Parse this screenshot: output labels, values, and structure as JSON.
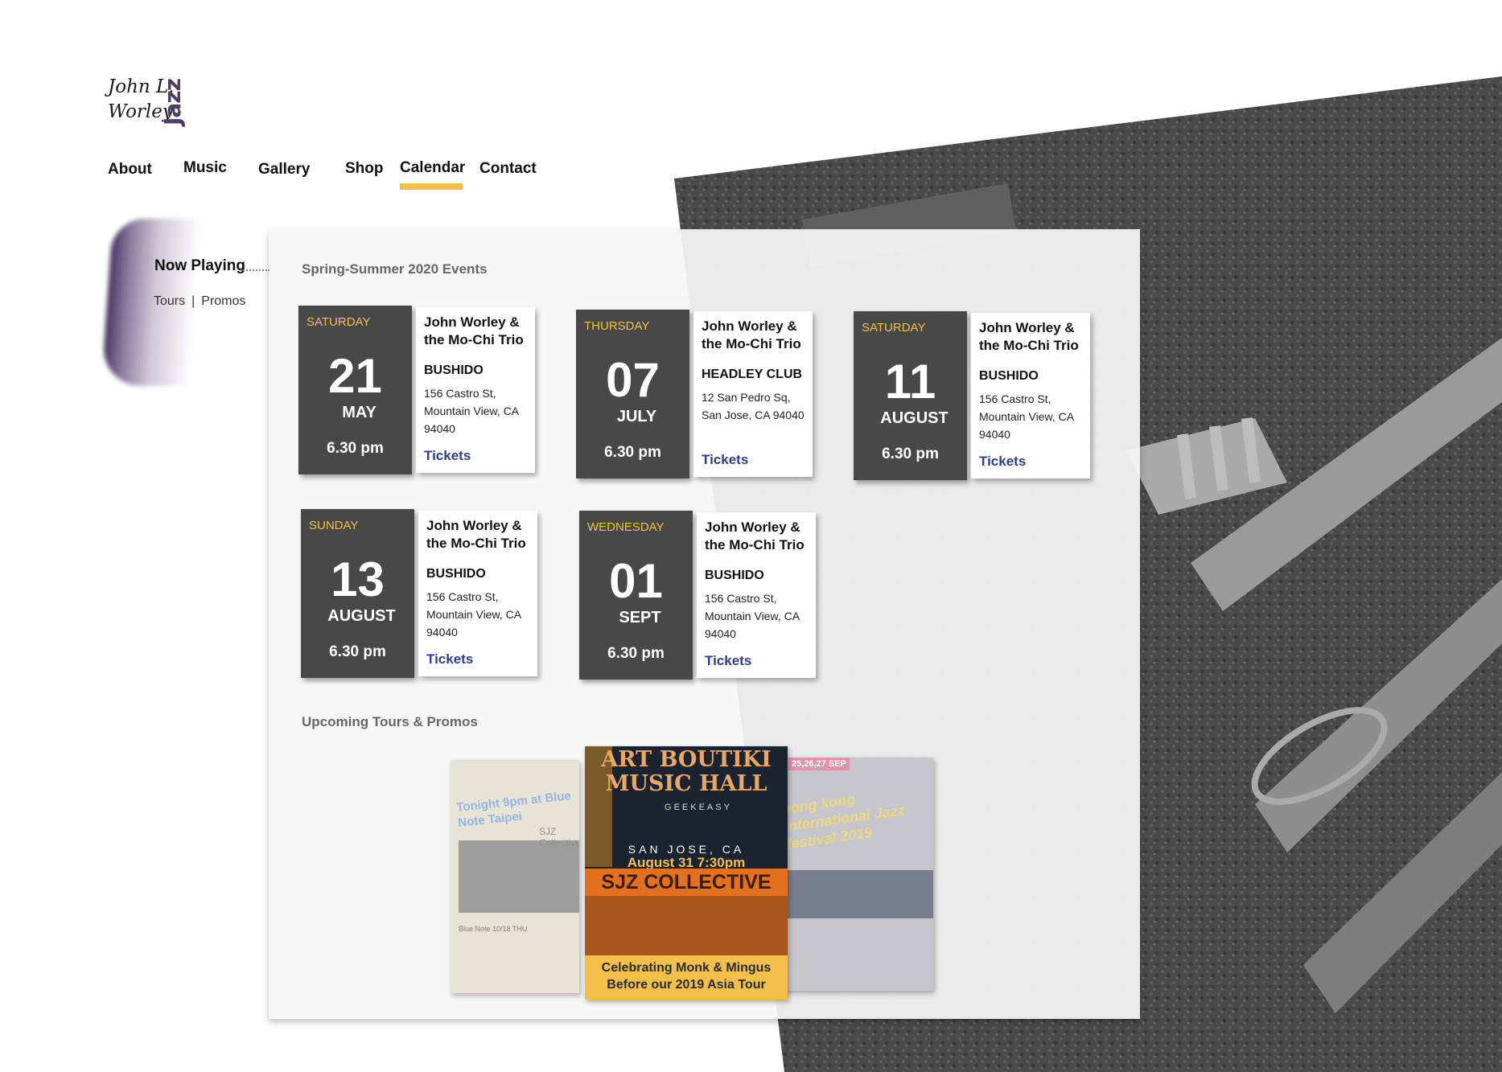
{
  "logo": {
    "script_line1": "John L.",
    "script_line2": "Worley",
    "word": "Jazz"
  },
  "nav": {
    "items": [
      "About",
      "Music",
      "Gallery",
      "Shop",
      "Calendar",
      "Contact"
    ],
    "active": "Calendar",
    "active_color": "#f2c04a"
  },
  "side": {
    "now_playing": "Now Playing",
    "links": [
      "Tours",
      "Promos"
    ],
    "separator": "|"
  },
  "main": {
    "events_title": "Spring-Summer 2020 Events",
    "promos_title": "Upcoming Tours & Promos"
  },
  "events": [
    {
      "weekday": "SATURDAY",
      "day": "21",
      "month": "MAY",
      "time": "6.30 pm",
      "band": "John Worley & the Mo-Chi Trio",
      "venue": "BUSHIDO",
      "address": "156 Castro St, Mountain View, CA 94040",
      "tickets": "Tickets"
    },
    {
      "weekday": "THURSDAY",
      "day": "07",
      "month": "JULY",
      "time": "6.30 pm",
      "band": "John Worley & the Mo-Chi Trio",
      "venue": "HEADLEY CLUB",
      "address": "12 San Pedro Sq, San Jose, CA 94040",
      "tickets": "Tickets"
    },
    {
      "weekday": "SATURDAY",
      "day": "11",
      "month": "AUGUST",
      "time": "6.30 pm",
      "band": "John Worley & the Mo-Chi Trio",
      "venue": "BUSHIDO",
      "address": "156 Castro St, Mountain View, CA 94040",
      "tickets": "Tickets"
    },
    {
      "weekday": "SUNDAY",
      "day": "13",
      "month": "AUGUST",
      "time": "6.30 pm",
      "band": "John Worley & the Mo-Chi Trio",
      "venue": "BUSHIDO",
      "address": "156 Castro St, Mountain View, CA 94040",
      "tickets": "Tickets"
    },
    {
      "weekday": "WEDNESDAY",
      "day": "01",
      "month": "SEPT",
      "time": "6.30 pm",
      "band": "John Worley & the Mo-Chi Trio",
      "venue": "BUSHIDO",
      "address": "156 Castro St, Mountain View, CA 94040",
      "tickets": "Tickets"
    }
  ],
  "posters": {
    "left": {
      "headline": "Tonight 9pm at Blue Note Taipei",
      "subtitle": "SJZ Collective",
      "note": "Blue Note 10/18 THU"
    },
    "center": {
      "title": "ART BOUTIKI MUSIC HALL",
      "venue": "GEEKEASY",
      "city": "SAN JOSE, CA",
      "date": "August 31 7:30pm",
      "band": "SJZ COLLECTIVE",
      "footer": "Celebrating Monk & Mingus Before our 2019 Asia Tour"
    },
    "right": {
      "top": "25,26,27 SEP",
      "headline": "hong kong international Jazz festival 2019"
    }
  },
  "colors": {
    "accent": "#f2c04a",
    "date_box": "#484848",
    "tickets": "#2d3e8f",
    "logo_purple": "#4e3d66"
  }
}
